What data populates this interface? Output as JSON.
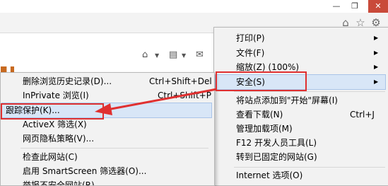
{
  "window": {
    "min_glyph": "—",
    "restore_glyph": "❐",
    "close_glyph": "✕"
  },
  "toolbar_icons": [
    "home-icon",
    "favorites-star-icon",
    "tools-gear-icon"
  ],
  "tools_menu": {
    "items": [
      {
        "label": "打印(P)",
        "submenu": true
      },
      {
        "label": "文件(F)",
        "submenu": true
      },
      {
        "label": "缩放(Z) (100%)",
        "submenu": true
      },
      {
        "label": "安全(S)",
        "submenu": true,
        "highlighted": true
      },
      {
        "label": "将站点添加到\"开始\"屏幕(I)"
      },
      {
        "label": "查看下载(N)",
        "accelerator": "Ctrl+J"
      },
      {
        "label": "管理加载项(M)"
      },
      {
        "label": "F12 开发人员工具(L)"
      },
      {
        "label": "转到已固定的网站(G)"
      },
      {
        "label": "Internet 选项(O)"
      }
    ]
  },
  "safety_submenu": {
    "items": [
      {
        "label": "删除浏览历史记录(D)...",
        "accelerator": "Ctrl+Shift+Del"
      },
      {
        "label": "InPrivate 浏览(I)",
        "accelerator": "Ctrl+Shift+P"
      },
      {
        "label": "跟踪保护(K)...",
        "highlighted": true
      },
      {
        "label": "ActiveX 筛选(X)"
      },
      {
        "label": "网页隐私策略(V)..."
      },
      {
        "label": "检查此网站(C)"
      },
      {
        "label": "启用 SmartScreen 筛选器(O)..."
      },
      {
        "label": "举报不安全网站(R)"
      }
    ]
  },
  "colors": {
    "annotation": "#e03030",
    "highlight": "#d8e6f7"
  }
}
